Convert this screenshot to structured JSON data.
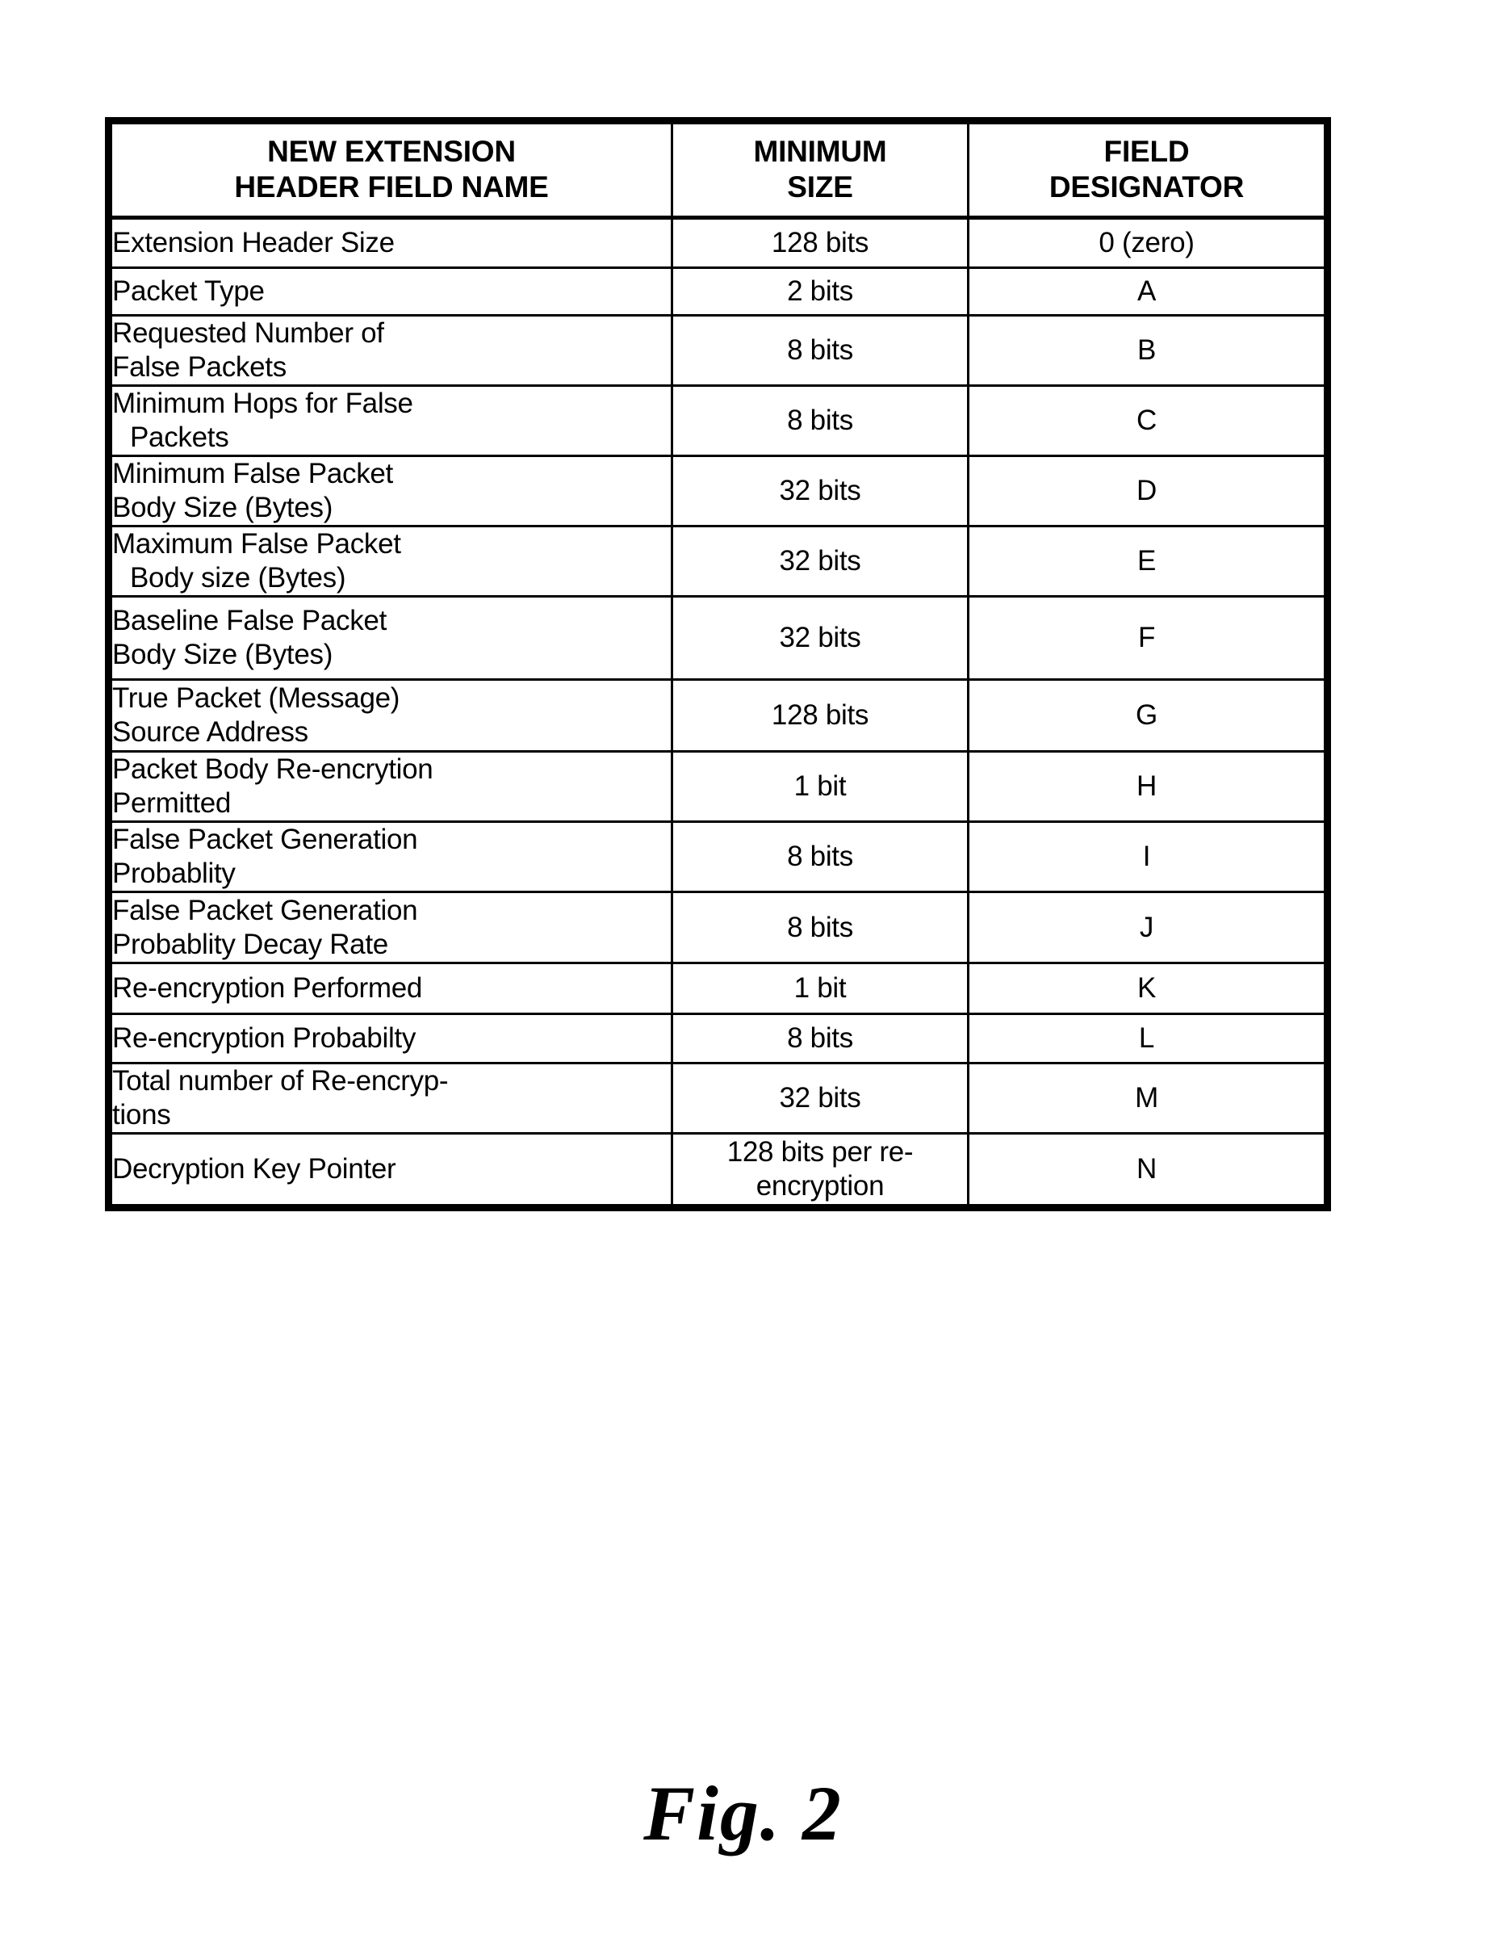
{
  "figure": {
    "caption": "Fig. 2"
  },
  "table": {
    "columns": [
      {
        "id": "field_name",
        "header_line1": "NEW EXTENSION",
        "header_line2": "HEADER FIELD NAME"
      },
      {
        "id": "minimum_size",
        "header_line1": "MINIMUM",
        "header_line2": "SIZE"
      },
      {
        "id": "field_designator",
        "header_line1": "FIELD",
        "header_line2": "DESIGNATOR"
      }
    ],
    "rows": [
      {
        "name_line1": "Extension Header Size",
        "name_line2": "",
        "size_line1": "128 bits",
        "size_line2": "",
        "designator": "0 (zero)"
      },
      {
        "name_line1": "Packet Type",
        "name_line2": "",
        "size_line1": "2 bits",
        "size_line2": "",
        "designator": "A"
      },
      {
        "name_line1": "Requested Number of",
        "name_line2": "False Packets",
        "size_line1": "8 bits",
        "size_line2": "",
        "designator": "B"
      },
      {
        "name_line1": "Minimum Hops for False",
        "name_line2": "Packets",
        "size_line1": "8 bits",
        "size_line2": "",
        "designator": "C"
      },
      {
        "name_line1": "Minimum False Packet",
        "name_line2": "Body Size (Bytes)",
        "size_line1": "32 bits",
        "size_line2": "",
        "designator": "D"
      },
      {
        "name_line1": "Maximum False Packet",
        "name_line2": "Body size (Bytes)",
        "size_line1": "32 bits",
        "size_line2": "",
        "designator": "E"
      },
      {
        "name_line1": "Baseline False Packet",
        "name_line2": "Body Size (Bytes)",
        "size_line1": "32 bits",
        "size_line2": "",
        "designator": "F"
      },
      {
        "name_line1": "True Packet (Message)",
        "name_line2": "Source Address",
        "size_line1": "128 bits",
        "size_line2": "",
        "designator": "G"
      },
      {
        "name_line1": "Packet Body Re-encrytion",
        "name_line2": "Permitted",
        "size_line1": "1 bit",
        "size_line2": "",
        "designator": "H"
      },
      {
        "name_line1": "False Packet Generation",
        "name_line2": "Probablity",
        "size_line1": "8 bits",
        "size_line2": "",
        "designator": "I"
      },
      {
        "name_line1": "False Packet Generation",
        "name_line2": "Probablity Decay Rate",
        "size_line1": "8 bits",
        "size_line2": "",
        "designator": "J"
      },
      {
        "name_line1": "Re-encryption Performed",
        "name_line2": "",
        "size_line1": "1 bit",
        "size_line2": "",
        "designator": "K"
      },
      {
        "name_line1": "Re-encryption Probabilty",
        "name_line2": "",
        "size_line1": "8 bits",
        "size_line2": "",
        "designator": "L"
      },
      {
        "name_line1": "Total number of Re-encryp-",
        "name_line2": "tions",
        "size_line1": "32 bits",
        "size_line2": "",
        "designator": "M"
      },
      {
        "name_line1": "Decryption Key Pointer",
        "name_line2": "",
        "size_line1": "128 bits per re-",
        "size_line2": "encryption",
        "designator": "N"
      }
    ]
  }
}
